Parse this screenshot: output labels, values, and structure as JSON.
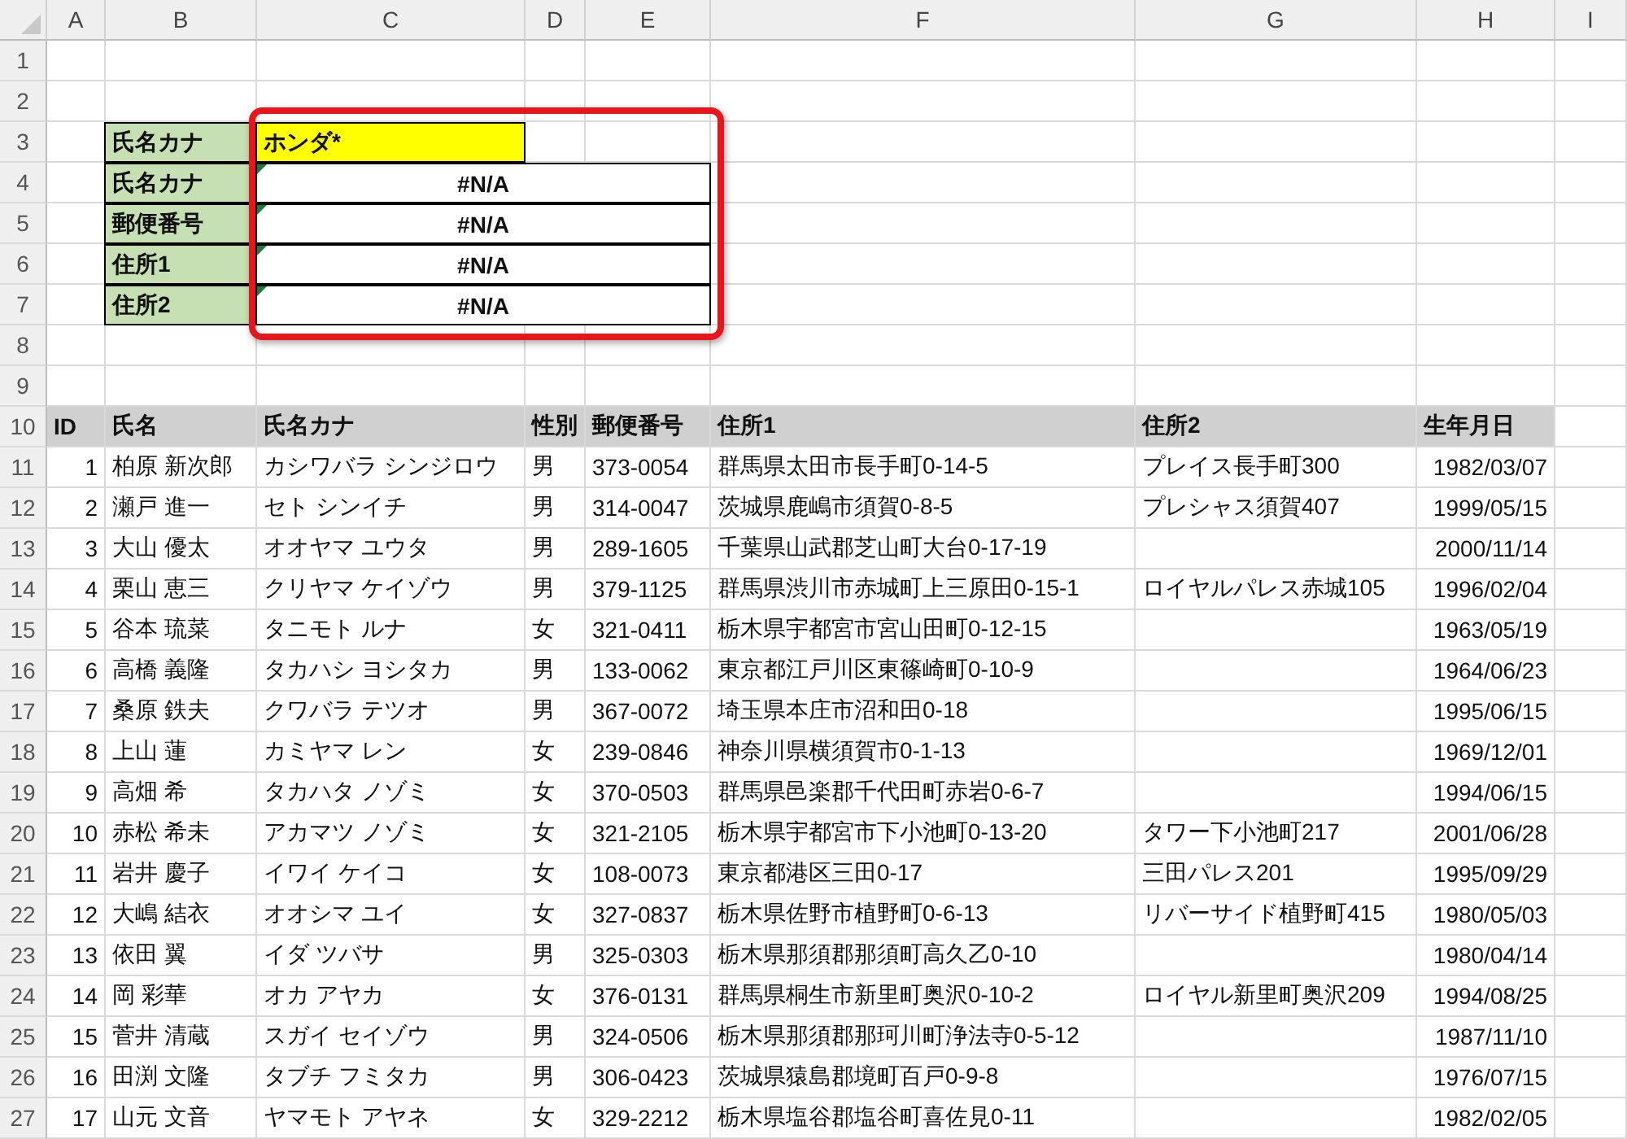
{
  "column_headers": [
    "A",
    "B",
    "C",
    "D",
    "E",
    "F",
    "G",
    "H",
    "I"
  ],
  "row_numbers": [
    "1",
    "2",
    "3",
    "4",
    "5",
    "6",
    "7",
    "8",
    "9",
    "10",
    "11",
    "12",
    "13",
    "14",
    "15",
    "16",
    "17",
    "18",
    "19",
    "20",
    "21",
    "22",
    "23",
    "24",
    "25",
    "26",
    "27"
  ],
  "lookup_form": {
    "highlighted": true,
    "fields": [
      {
        "label": "氏名カナ",
        "kind": "input",
        "value": "ホンダ*"
      },
      {
        "label": "氏名カナ",
        "kind": "result",
        "value": "#N/A",
        "error_flag": true
      },
      {
        "label": "郵便番号",
        "kind": "result",
        "value": "#N/A",
        "error_flag": true
      },
      {
        "label": "住所1",
        "kind": "result",
        "value": "#N/A",
        "error_flag": true
      },
      {
        "label": "住所2",
        "kind": "result",
        "value": "#N/A",
        "error_flag": true
      }
    ]
  },
  "table": {
    "columns": [
      "ID",
      "氏名",
      "氏名カナ",
      "性別",
      "郵便番号",
      "住所1",
      "住所2",
      "生年月日"
    ],
    "rows": [
      {
        "id": "1",
        "name": "柏原 新次郎",
        "kana": "カシワバラ シンジロウ",
        "sex": "男",
        "zip": "373-0054",
        "address1": "群馬県太田市長手町0-14-5",
        "address2": "プレイス長手町300",
        "birthdate": "1982/03/07"
      },
      {
        "id": "2",
        "name": "瀬戸 進一",
        "kana": "セト シンイチ",
        "sex": "男",
        "zip": "314-0047",
        "address1": "茨城県鹿嶋市須賀0-8-5",
        "address2": "プレシャス須賀407",
        "birthdate": "1999/05/15"
      },
      {
        "id": "3",
        "name": "大山 優太",
        "kana": "オオヤマ ユウタ",
        "sex": "男",
        "zip": "289-1605",
        "address1": "千葉県山武郡芝山町大台0-17-19",
        "birthdate": "2000/11/14"
      },
      {
        "id": "4",
        "name": "栗山 恵三",
        "kana": "クリヤマ ケイゾウ",
        "sex": "男",
        "zip": "379-1125",
        "address1": "群馬県渋川市赤城町上三原田0-15-1",
        "address2": "ロイヤルパレス赤城105",
        "birthdate": "1996/02/04"
      },
      {
        "id": "5",
        "name": "谷本 琉菜",
        "kana": "タニモト ルナ",
        "sex": "女",
        "zip": "321-0411",
        "address1": "栃木県宇都宮市宮山田町0-12-15",
        "birthdate": "1963/05/19"
      },
      {
        "id": "6",
        "name": "高橋 義隆",
        "kana": "タカハシ ヨシタカ",
        "sex": "男",
        "zip": "133-0062",
        "address1": "東京都江戸川区東篠崎町0-10-9",
        "birthdate": "1964/06/23"
      },
      {
        "id": "7",
        "name": "桑原 鉄夫",
        "kana": "クワバラ テツオ",
        "sex": "男",
        "zip": "367-0072",
        "address1": "埼玉県本庄市沼和田0-18",
        "birthdate": "1995/06/15"
      },
      {
        "id": "8",
        "name": "上山 蓮",
        "kana": "カミヤマ レン",
        "sex": "女",
        "zip": "239-0846",
        "address1": "神奈川県横須賀市0-1-13",
        "birthdate": "1969/12/01"
      },
      {
        "id": "9",
        "name": "高畑 希",
        "kana": "タカハタ ノゾミ",
        "sex": "女",
        "zip": "370-0503",
        "address1": "群馬県邑楽郡千代田町赤岩0-6-7",
        "birthdate": "1994/06/15"
      },
      {
        "id": "10",
        "name": "赤松 希未",
        "kana": "アカマツ ノゾミ",
        "sex": "女",
        "zip": "321-2105",
        "address1": "栃木県宇都宮市下小池町0-13-20",
        "address2": "タワー下小池町217",
        "birthdate": "2001/06/28"
      },
      {
        "id": "11",
        "name": "岩井 慶子",
        "kana": "イワイ ケイコ",
        "sex": "女",
        "zip": "108-0073",
        "address1": "東京都港区三田0-17",
        "address2": "三田パレス201",
        "birthdate": "1995/09/29"
      },
      {
        "id": "12",
        "name": "大嶋 結衣",
        "kana": "オオシマ ユイ",
        "sex": "女",
        "zip": "327-0837",
        "address1": "栃木県佐野市植野町0-6-13",
        "address2": "リバーサイド植野町415",
        "birthdate": "1980/05/03"
      },
      {
        "id": "13",
        "name": "依田 翼",
        "kana": "イダ ツバサ",
        "sex": "男",
        "zip": "325-0303",
        "address1": "栃木県那須郡那須町高久乙0-10",
        "birthdate": "1980/04/14"
      },
      {
        "id": "14",
        "name": "岡 彩華",
        "kana": "オカ アヤカ",
        "sex": "女",
        "zip": "376-0131",
        "address1": "群馬県桐生市新里町奥沢0-10-2",
        "address2": "ロイヤル新里町奥沢209",
        "birthdate": "1994/08/25"
      },
      {
        "id": "15",
        "name": "菅井 清蔵",
        "kana": "スガイ セイゾウ",
        "sex": "男",
        "zip": "324-0506",
        "address1": "栃木県那須郡那珂川町浄法寺0-5-12",
        "birthdate": "1987/11/10"
      },
      {
        "id": "16",
        "name": "田渕 文隆",
        "kana": "タブチ フミタカ",
        "sex": "男",
        "zip": "306-0423",
        "address1": "茨城県猿島郡境町百戸0-9-8",
        "birthdate": "1976/07/15"
      },
      {
        "id": "17",
        "name": "山元 文音",
        "kana": "ヤマモト アヤネ",
        "sex": "女",
        "zip": "329-2212",
        "address1": "栃木県塩谷郡塩谷町喜佐見0-11",
        "birthdate": "1982/02/05"
      }
    ]
  }
}
